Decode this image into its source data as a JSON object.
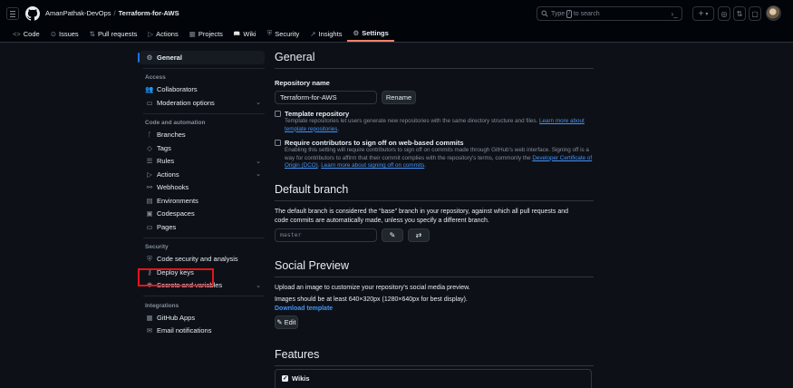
{
  "header": {
    "owner": "AmanPathak-DevOps",
    "separator": "/",
    "repo": "Terraform-for-AWS",
    "search_prefix": "Type",
    "search_key": "/",
    "search_suffix": "to search",
    "plus_label": "+",
    "caret": "▾"
  },
  "nav": {
    "tabs": [
      {
        "icon": "<>",
        "label": "Code"
      },
      {
        "icon": "⊙",
        "label": "Issues"
      },
      {
        "icon": "⇅",
        "label": "Pull requests"
      },
      {
        "icon": "▷",
        "label": "Actions"
      },
      {
        "icon": "▦",
        "label": "Projects"
      },
      {
        "icon": "📖",
        "label": "Wiki"
      },
      {
        "icon": "⛨",
        "label": "Security"
      },
      {
        "icon": "↗",
        "label": "Insights"
      },
      {
        "icon": "⚙",
        "label": "Settings"
      }
    ]
  },
  "sidebar": {
    "general": "General",
    "access_heading": "Access",
    "collaborators": "Collaborators",
    "moderation": "Moderation options",
    "code_heading": "Code and automation",
    "branches": "Branches",
    "tags": "Tags",
    "rules": "Rules",
    "actions": "Actions",
    "webhooks": "Webhooks",
    "environments": "Environments",
    "codespaces": "Codespaces",
    "pages": "Pages",
    "security_heading": "Security",
    "code_security": "Code security and analysis",
    "deploy_keys": "Deploy keys",
    "secrets": "Secrets and variables",
    "integrations_heading": "Integrations",
    "github_apps": "GitHub Apps",
    "email": "Email notifications"
  },
  "main": {
    "general_title": "General",
    "repo_name_label": "Repository name",
    "repo_name_value": "Terraform-for-AWS",
    "rename_button": "Rename",
    "template_label": "Template repository",
    "template_desc": "Template repositories let users generate new repositories with the same directory structure and files.",
    "template_link": "Learn more about template repositories",
    "signoff_label": "Require contributors to sign off on web-based commits",
    "signoff_desc": "Enabling this setting will require contributors to sign off on commits made through GitHub's web interface. Signing off is a way for contributors to affirm that their commit complies with the repository's terms, commonly the",
    "signoff_dco": "Developer Certificate of Origin (DCO)",
    "signoff_link": "Learn more about signing off on commits",
    "default_branch_title": "Default branch",
    "default_branch_desc": "The default branch is considered the “base” branch in your repository, against which all pull requests and code commits are automatically made, unless you specify a different branch.",
    "default_branch_value": "master",
    "social_title": "Social Preview",
    "social_desc": "Upload an image to customize your repository's social media preview.",
    "social_size": "Images should be at least 640×320px (1280×640px for best display).",
    "download_template": "Download template",
    "edit_button": "Edit",
    "features_title": "Features",
    "wikis_label": "Wikis"
  }
}
